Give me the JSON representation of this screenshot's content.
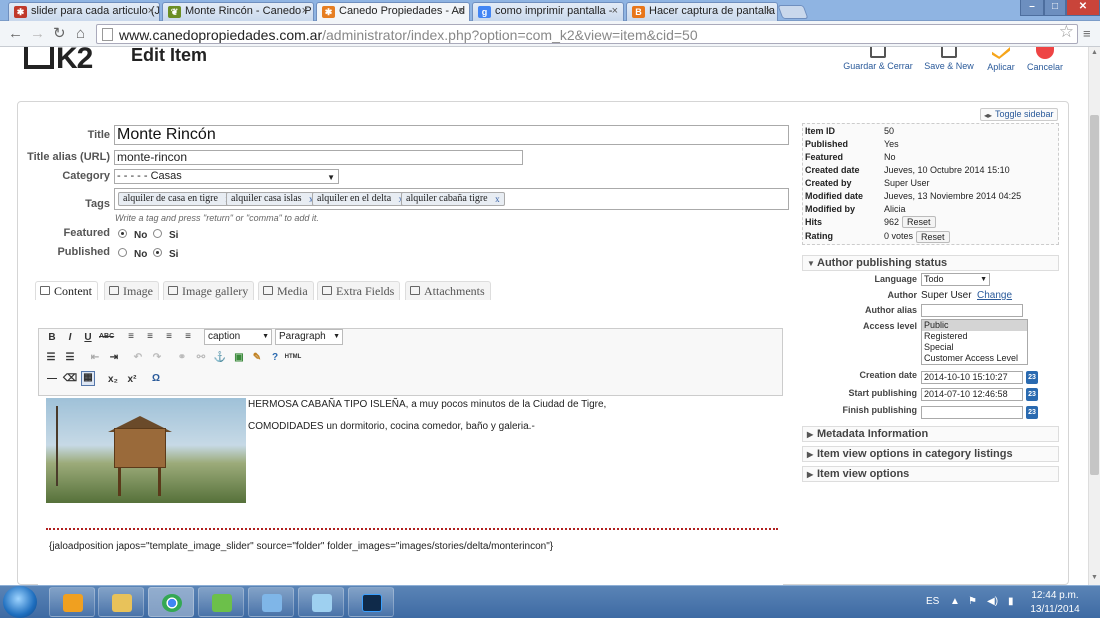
{
  "browser": {
    "tabs": [
      {
        "label": "slider para cada articulo (J",
        "icon": "joomla-red-icon",
        "color": "#c0392b"
      },
      {
        "label": "Monte Rincón - Canedo P",
        "icon": "leaf-icon",
        "color": "#6b8e23"
      },
      {
        "label": "Canedo Propiedades - Ad",
        "icon": "joomla-icon",
        "color": "#e67e22",
        "active": true
      },
      {
        "label": "como imprimir pantalla -",
        "icon": "google-icon",
        "color": "#4285f4"
      },
      {
        "label": "Hacer captura de pantalla",
        "icon": "blogger-icon",
        "color": "#e8761a"
      }
    ],
    "url_domain": "www.canedopropiedades.com.ar",
    "url_path": "/administrator/index.php?option=com_k2&view=item&cid=50"
  },
  "header": {
    "logo": "K2",
    "page_title": "Edit Item",
    "toolbar": [
      {
        "label": "Guardar & Cerrar",
        "icon": "save-close-icon"
      },
      {
        "label": "Save & New",
        "icon": "save-new-icon"
      },
      {
        "label": "Aplicar",
        "icon": "apply-check-icon"
      },
      {
        "label": "Cancelar",
        "icon": "cancel-icon"
      }
    ],
    "toggle_sidebar": "Toggle sidebar"
  },
  "form": {
    "title_label": "Title",
    "title_value": "Monte Rincón",
    "alias_label": "Title alias (URL)",
    "alias_value": "monte-rincon",
    "category_label": "Category",
    "category_value": "- - - - - Casas",
    "tags_label": "Tags",
    "tags": [
      "alquiler de casa en tigre",
      "alquiler casa islas",
      "alquiler en el delta",
      "alquiler cabaña tigre"
    ],
    "tag_remove": "x",
    "tags_hint": "Write a tag and press \"return\" or \"comma\" to add it.",
    "featured_label": "Featured",
    "published_label": "Published",
    "no": "No",
    "si": "Si",
    "featured_value": "No",
    "published_value": "Si"
  },
  "content_tabs": [
    "Content",
    "Image",
    "Image gallery",
    "Media",
    "Extra Fields",
    "Attachments"
  ],
  "editor": {
    "style_select": "caption",
    "format_select": "Paragraph",
    "buttons_row1": [
      "B",
      "I",
      "U",
      "ABC"
    ],
    "special_buttons": [
      "x₂",
      "x²",
      "Ω",
      "HTML"
    ],
    "line1": "HERMOSA CABAÑA TIPO ISLEÑA, a muy pocos minutos de la Ciudad de Tigre,",
    "line2": "COMODIDADES un dormitorio, cocina comedor, baño y galeria.-",
    "plugin_code": "{jaloadposition japos=\"template_image_slider\" source=\"folder\" folder_images=\"images/stories/delta/monterincon\"}"
  },
  "item_info": {
    "rows": [
      {
        "label": "Item ID",
        "value": "50"
      },
      {
        "label": "Published",
        "value": "Yes"
      },
      {
        "label": "Featured",
        "value": "No"
      },
      {
        "label": "Created date",
        "value": "Jueves, 10 Octubre 2014 15:10"
      },
      {
        "label": "Created by",
        "value": "Super User"
      },
      {
        "label": "Modified date",
        "value": "Jueves, 13 Noviembre 2014 04:25"
      },
      {
        "label": "Modified by",
        "value": "Alicia"
      },
      {
        "label": "Hits",
        "value": "962"
      },
      {
        "label": "Rating",
        "value": "0 votes"
      }
    ],
    "reset": "Reset"
  },
  "publishing": {
    "title": "Author publishing status",
    "language_label": "Language",
    "language_value": "Todo",
    "author_label": "Author",
    "author_value": "Super User",
    "change": "Change",
    "author_alias_label": "Author alias",
    "access_label": "Access level",
    "access_options": [
      "Public",
      "Registered",
      "Special",
      "Customer Access Level"
    ],
    "access_selected": "Public",
    "creation_label": "Creation date",
    "creation_value": "2014-10-10 15:10:27",
    "start_label": "Start publishing",
    "start_value": "2014-07-10 12:46:58",
    "finish_label": "Finish publishing",
    "finish_value": "",
    "cal": "23"
  },
  "accordions": [
    "Metadata Information",
    "Item view options in category listings",
    "Item view options"
  ],
  "taskbar": {
    "lang": "ES",
    "time": "12:44 p.m.",
    "date": "13/11/2014",
    "apps": [
      {
        "icon": "media-player-icon",
        "color": "#f0a020"
      },
      {
        "icon": "explorer-folder-icon",
        "color": "#e8c25a"
      },
      {
        "icon": "chrome-icon",
        "color": "#34a853"
      },
      {
        "icon": "network-app-icon",
        "color": "#6cc04a"
      },
      {
        "icon": "image-viewer-icon",
        "color": "#7fb6e8"
      },
      {
        "icon": "notes-app-icon",
        "color": "#9ed0f0"
      },
      {
        "icon": "photoshop-icon",
        "color": "#0f2a4a"
      }
    ]
  }
}
